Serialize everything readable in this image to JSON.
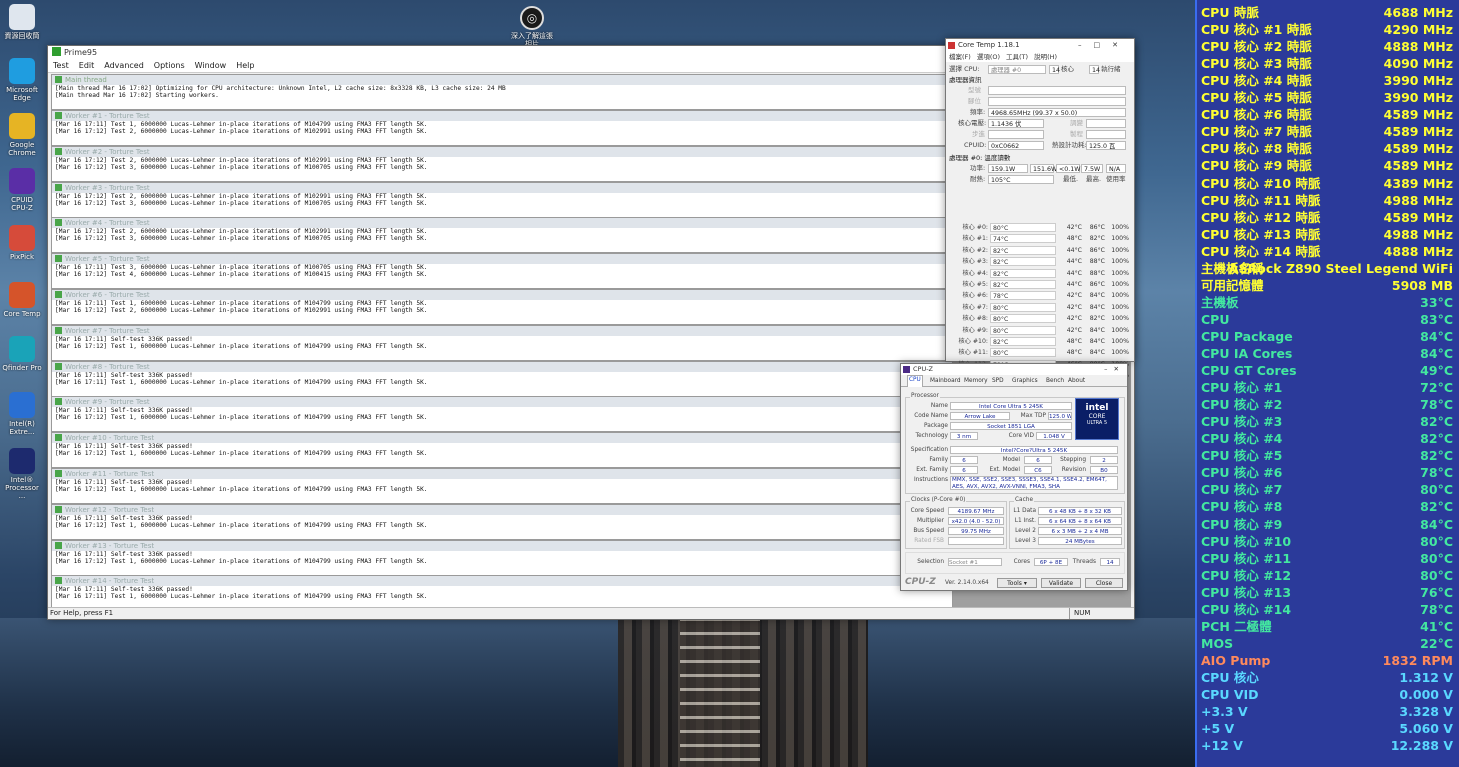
{
  "desktop": {
    "icons": [
      {
        "label": "資源回收筒",
        "icon": "recycle-bin-icon",
        "color": "#dfe6ee"
      },
      {
        "label": "Microsoft Edge",
        "icon": "edge-icon",
        "color": "#1f9de0"
      },
      {
        "label": "Google Chrome",
        "icon": "chrome-icon",
        "color": "#e6b424"
      },
      {
        "label": "CPUID CPU-Z",
        "icon": "cpuz-icon",
        "color": "#5a2ea6"
      },
      {
        "label": "PixPick",
        "icon": "pixpick-icon",
        "color": "#d64b3a"
      },
      {
        "label": "Core Temp",
        "icon": "coretemp-icon",
        "color": "#d5542a"
      },
      {
        "label": "Qfinder Pro",
        "icon": "qfinder-icon",
        "color": "#1aa3b8"
      },
      {
        "label": "Intel(R) Extre...",
        "icon": "intel-xtu-icon",
        "color": "#2a6fd2"
      },
      {
        "label": "Intel® Processor ...",
        "icon": "intel-pdt-icon",
        "color": "#1d2a6e"
      }
    ],
    "top_icon_label": "深入了解這張相片"
  },
  "prime95": {
    "title": "Prime95",
    "menu": [
      "Test",
      "Edit",
      "Advanced",
      "Options",
      "Window",
      "Help"
    ],
    "main_thread": {
      "title": "Main thread",
      "lines": [
        "[Main thread Mar 16 17:02] Optimizing for CPU architecture: Unknown Intel, L2 cache size: 8x3328 KB, L3 cache size: 24 MB",
        "[Main thread Mar 16 17:02] Starting workers."
      ]
    },
    "workers": [
      {
        "title": "Worker #1 - Torture Test",
        "lines": [
          "[Mar 16 17:11] Test 1, 6000000 Lucas-Lehmer in-place iterations of M104799 using FMA3 FFT length 5K.",
          "[Mar 16 17:12] Test 2, 6000000 Lucas-Lehmer in-place iterations of M102991 using FMA3 FFT length 5K."
        ]
      },
      {
        "title": "Worker #2 - Torture Test",
        "lines": [
          "[Mar 16 17:12] Test 2, 6000000 Lucas-Lehmer in-place iterations of M102991 using FMA3 FFT length 5K.",
          "[Mar 16 17:12] Test 3, 6000000 Lucas-Lehmer in-place iterations of M100705 using FMA3 FFT length 5K."
        ]
      },
      {
        "title": "Worker #3 - Torture Test",
        "lines": [
          "[Mar 16 17:12] Test 2, 6000000 Lucas-Lehmer in-place iterations of M102991 using FMA3 FFT length 5K.",
          "[Mar 16 17:12] Test 3, 6000000 Lucas-Lehmer in-place iterations of M100705 using FMA3 FFT length 5K."
        ]
      },
      {
        "title": "Worker #4 - Torture Test",
        "lines": [
          "[Mar 16 17:12] Test 2, 6000000 Lucas-Lehmer in-place iterations of M102991 using FMA3 FFT length 5K.",
          "[Mar 16 17:12] Test 3, 6000000 Lucas-Lehmer in-place iterations of M100705 using FMA3 FFT length 5K."
        ]
      },
      {
        "title": "Worker #5 - Torture Test",
        "lines": [
          "[Mar 16 17:11] Test 3, 6000000 Lucas-Lehmer in-place iterations of M100705 using FMA3 FFT length 5K.",
          "[Mar 16 17:12] Test 4, 6000000 Lucas-Lehmer in-place iterations of M100415 using FMA3 FFT length 5K."
        ]
      },
      {
        "title": "Worker #6 - Torture Test",
        "lines": [
          "[Mar 16 17:11] Test 1, 6000000 Lucas-Lehmer in-place iterations of M104799 using FMA3 FFT length 5K.",
          "[Mar 16 17:12] Test 2, 6000000 Lucas-Lehmer in-place iterations of M102991 using FMA3 FFT length 5K."
        ]
      },
      {
        "title": "Worker #7 - Torture Test",
        "lines": [
          "[Mar 16 17:11] Self-test 336K passed!",
          "[Mar 16 17:12] Test 1, 6000000 Lucas-Lehmer in-place iterations of M104799 using FMA3 FFT length 5K."
        ]
      },
      {
        "title": "Worker #8 - Torture Test",
        "lines": [
          "[Mar 16 17:11] Self-test 336K passed!",
          "[Mar 16 17:11] Test 1, 6000000 Lucas-Lehmer in-place iterations of M104799 using FMA3 FFT length 5K."
        ]
      },
      {
        "title": "Worker #9 - Torture Test",
        "lines": [
          "[Mar 16 17:11] Self-test 336K passed!",
          "[Mar 16 17:12] Test 1, 6000000 Lucas-Lehmer in-place iterations of M104799 using FMA3 FFT length 5K."
        ]
      },
      {
        "title": "Worker #10 - Torture Test",
        "lines": [
          "[Mar 16 17:11] Self-test 336K passed!",
          "[Mar 16 17:12] Test 1, 6000000 Lucas-Lehmer in-place iterations of M104799 using FMA3 FFT length 5K."
        ]
      },
      {
        "title": "Worker #11 - Torture Test",
        "lines": [
          "[Mar 16 17:11] Self-test 336K passed!",
          "[Mar 16 17:12] Test 1, 6000000 Lucas-Lehmer in-place iterations of M104799 using FMA3 FFT length 5K."
        ]
      },
      {
        "title": "Worker #12 - Torture Test",
        "lines": [
          "[Mar 16 17:11] Self-test 336K passed!",
          "[Mar 16 17:12] Test 1, 6000000 Lucas-Lehmer in-place iterations of M104799 using FMA3 FFT length 5K."
        ]
      },
      {
        "title": "Worker #13 - Torture Test",
        "lines": [
          "[Mar 16 17:11] Self-test 336K passed!",
          "[Mar 16 17:12] Test 1, 6000000 Lucas-Lehmer in-place iterations of M104799 using FMA3 FFT length 5K."
        ]
      },
      {
        "title": "Worker #14 - Torture Test",
        "lines": [
          "[Mar 16 17:11] Self-test 336K passed!",
          "[Mar 16 17:11] Test 1, 6000000 Lucas-Lehmer in-place iterations of M104799 using FMA3 FFT length 5K."
        ]
      }
    ],
    "status_left": "For Help, press F1",
    "status_num": "NUM"
  },
  "coretemp": {
    "title": "Core Temp 1.18.1",
    "menu": [
      "檔案(F)",
      "選項(O)",
      "工具(T)",
      "說明(H)"
    ],
    "select_cpu_label": "選擇 CPU:",
    "select_cpu_value": "處理器 #0",
    "cores_value": "14",
    "cores_label": "核心",
    "threads_value": "14",
    "threads_label": "執行緒",
    "proc_info_title": "處理器資訊",
    "model_label": "型號",
    "platform_label": "腳位",
    "freq_label": "頻率:",
    "freq_value": "4968.65MHz (99.37 x 50.0)",
    "vid_label": "核心電壓:",
    "vid_value": "1.1436 伏",
    "mod_label": "調變",
    "lith_label": "步進",
    "rev_label": "製程",
    "cpuid_label": "CPUID:",
    "cpuid_value": "0xC0662",
    "tdp_label": "熱設計功耗:",
    "tdp_value": "125.0 瓦",
    "reading_title": "處理器 #0: 溫度讀數",
    "power_label": "功率:",
    "power_values": [
      "159.1W",
      "151.6W",
      "<0.1W",
      "7.5W",
      "N/A"
    ],
    "tj_label": "耐熱:",
    "tj_value": "105°C",
    "col_min": "最低.",
    "col_max": "最高.",
    "col_load": "使用率",
    "cores": [
      {
        "label": "核心 #0:",
        "temp": "80°C",
        "min": "42°C",
        "max": "86°C",
        "load": "100%"
      },
      {
        "label": "核心 #1:",
        "temp": "74°C",
        "min": "48°C",
        "max": "82°C",
        "load": "100%"
      },
      {
        "label": "核心 #2:",
        "temp": "82°C",
        "min": "44°C",
        "max": "86°C",
        "load": "100%"
      },
      {
        "label": "核心 #3:",
        "temp": "82°C",
        "min": "44°C",
        "max": "88°C",
        "load": "100%"
      },
      {
        "label": "核心 #4:",
        "temp": "82°C",
        "min": "44°C",
        "max": "88°C",
        "load": "100%"
      },
      {
        "label": "核心 #5:",
        "temp": "82°C",
        "min": "44°C",
        "max": "86°C",
        "load": "100%"
      },
      {
        "label": "核心 #6:",
        "temp": "78°C",
        "min": "42°C",
        "max": "84°C",
        "load": "100%"
      },
      {
        "label": "核心 #7:",
        "temp": "80°C",
        "min": "42°C",
        "max": "84°C",
        "load": "100%"
      },
      {
        "label": "核心 #8:",
        "temp": "80°C",
        "min": "42°C",
        "max": "82°C",
        "load": "100%"
      },
      {
        "label": "核心 #9:",
        "temp": "80°C",
        "min": "42°C",
        "max": "84°C",
        "load": "100%"
      },
      {
        "label": "核心 #10:",
        "temp": "82°C",
        "min": "48°C",
        "max": "84°C",
        "load": "100%"
      },
      {
        "label": "核心 #11:",
        "temp": "80°C",
        "min": "48°C",
        "max": "84°C",
        "load": "100%"
      },
      {
        "label": "核心 #12:",
        "temp": "78°C",
        "min": "46°C",
        "max": "80°C",
        "load": "100%"
      },
      {
        "label": "核心 #13:",
        "temp": "76°C",
        "min": "44°C",
        "max": "78°C",
        "load": "100%"
      }
    ]
  },
  "cpuz": {
    "title": "CPU-Z",
    "tabs": [
      "CPU",
      "Mainboard",
      "Memory",
      "SPD",
      "Graphics",
      "Bench",
      "About"
    ],
    "processor_group": "Processor",
    "name_label": "Name",
    "name_value": "Intel Core Ultra 5 245K",
    "codename_label": "Code Name",
    "codename_value": "Arrow Lake",
    "maxtdp_label": "Max TDP",
    "maxtdp_value": "125.0 W",
    "package_label": "Package",
    "package_value": "Socket 1851 LGA",
    "tech_label": "Technology",
    "tech_value": "3 nm",
    "corevid_label": "Core VID",
    "corevid_value": "1.048 V",
    "spec_label": "Specification",
    "spec_value": "Intel?Core?Ultra 5 245K",
    "family_label": "Family",
    "family_value": "6",
    "model_label": "Model",
    "model_value": "6",
    "stepping_label": "Stepping",
    "stepping_value": "2",
    "extfamily_label": "Ext. Family",
    "extfamily_value": "6",
    "extmodel_label": "Ext. Model",
    "extmodel_value": "C6",
    "revision_label": "Revision",
    "revision_value": "B0",
    "instr_label": "Instructions",
    "instr_value": "MMX, SSE, SSE2, SSE3, SSSE3, SSE4.1, SSE4.2, EM64T, AES, AVX, AVX2, AVX-VNNI, FMA3, SHA",
    "logo_brand": "intel",
    "logo_line": "CORE",
    "logo_sub": "ULTRA",
    "logo_num": "5",
    "clocks_group": "Clocks (P-Core #0)",
    "corespeed_label": "Core Speed",
    "corespeed_value": "4189.67 MHz",
    "mult_label": "Multiplier",
    "mult_value": "x42.0 (4.0 - 52.0)",
    "bus_label": "Bus Speed",
    "bus_value": "99.75 MHz",
    "fsb_label": "Rated FSB",
    "fsb_value": "",
    "cache_group": "Cache",
    "l1d_label": "L1 Data",
    "l1d_value": "6 x 48 KB + 8 x 32 KB",
    "l1i_label": "L1 Inst.",
    "l1i_value": "6 x 64 KB + 8 x 64 KB",
    "l2_label": "Level 2",
    "l2_value": "6 x 3 MB + 2 x 4 MB",
    "l3_label": "Level 3",
    "l3_value": "24 MBytes",
    "selection_label": "Selection",
    "selection_value": "Socket #1",
    "cores_label": "Cores",
    "cores_value": "6P + 8E",
    "threads_label": "Threads",
    "threads_value": "14",
    "brand": "CPU-Z",
    "version": "Ver. 2.14.0.x64",
    "tools_btn": "Tools",
    "validate_btn": "Validate",
    "close_btn": "Close"
  },
  "sensors": [
    {
      "label": "CPU 時脈",
      "value": "4688 MHz",
      "color": "#ffff33"
    },
    {
      "label": "CPU 核心 #1 時脈",
      "value": "4290 MHz",
      "color": "#ffff33"
    },
    {
      "label": "CPU 核心 #2 時脈",
      "value": "4888 MHz",
      "color": "#ffff33"
    },
    {
      "label": "CPU 核心 #3 時脈",
      "value": "4090 MHz",
      "color": "#ffff33"
    },
    {
      "label": "CPU 核心 #4 時脈",
      "value": "3990 MHz",
      "color": "#ffff33"
    },
    {
      "label": "CPU 核心 #5 時脈",
      "value": "3990 MHz",
      "color": "#ffff33"
    },
    {
      "label": "CPU 核心 #6 時脈",
      "value": "4589 MHz",
      "color": "#ffff33"
    },
    {
      "label": "CPU 核心 #7 時脈",
      "value": "4589 MHz",
      "color": "#ffff33"
    },
    {
      "label": "CPU 核心 #8 時脈",
      "value": "4589 MHz",
      "color": "#ffff33"
    },
    {
      "label": "CPU 核心 #9 時脈",
      "value": "4589 MHz",
      "color": "#ffff33"
    },
    {
      "label": "CPU 核心 #10 時脈",
      "value": "4389 MHz",
      "color": "#ffff33"
    },
    {
      "label": "CPU 核心 #11 時脈",
      "value": "4988 MHz",
      "color": "#ffff33"
    },
    {
      "label": "CPU 核心 #12 時脈",
      "value": "4589 MHz",
      "color": "#ffff33"
    },
    {
      "label": "CPU 核心 #13 時脈",
      "value": "4988 MHz",
      "color": "#ffff33"
    },
    {
      "label": "CPU 核心 #14 時脈",
      "value": "4888 MHz",
      "color": "#ffff33"
    },
    {
      "label": "主機板名稱",
      "value": "ASRock Z890 Steel Legend WiFi",
      "color": "#ffff33"
    },
    {
      "label": "可用記憶體",
      "value": "5908 MB",
      "color": "#ffff33"
    },
    {
      "label": "主機板",
      "value": "33°C",
      "color": "#43e8a0"
    },
    {
      "label": "CPU",
      "value": "83°C",
      "color": "#43e8a0"
    },
    {
      "label": "CPU Package",
      "value": "84°C",
      "color": "#43e8a0"
    },
    {
      "label": "CPU IA Cores",
      "value": "84°C",
      "color": "#43e8a0"
    },
    {
      "label": "CPU GT Cores",
      "value": "49°C",
      "color": "#43e8a0"
    },
    {
      "label": "CPU 核心 #1",
      "value": "72°C",
      "color": "#43e8a0"
    },
    {
      "label": "CPU 核心 #2",
      "value": "78°C",
      "color": "#43e8a0"
    },
    {
      "label": "CPU 核心 #3",
      "value": "82°C",
      "color": "#43e8a0"
    },
    {
      "label": "CPU 核心 #4",
      "value": "82°C",
      "color": "#43e8a0"
    },
    {
      "label": "CPU 核心 #5",
      "value": "82°C",
      "color": "#43e8a0"
    },
    {
      "label": "CPU 核心 #6",
      "value": "78°C",
      "color": "#43e8a0"
    },
    {
      "label": "CPU 核心 #7",
      "value": "80°C",
      "color": "#43e8a0"
    },
    {
      "label": "CPU 核心 #8",
      "value": "82°C",
      "color": "#43e8a0"
    },
    {
      "label": "CPU 核心 #9",
      "value": "84°C",
      "color": "#43e8a0"
    },
    {
      "label": "CPU 核心 #10",
      "value": "80°C",
      "color": "#43e8a0"
    },
    {
      "label": "CPU 核心 #11",
      "value": "80°C",
      "color": "#43e8a0"
    },
    {
      "label": "CPU 核心 #12",
      "value": "80°C",
      "color": "#43e8a0"
    },
    {
      "label": "CPU 核心 #13",
      "value": "76°C",
      "color": "#43e8a0"
    },
    {
      "label": "CPU 核心 #14",
      "value": "78°C",
      "color": "#43e8a0"
    },
    {
      "label": "PCH 二極體",
      "value": "41°C",
      "color": "#43e8a0"
    },
    {
      "label": "MOS",
      "value": "22°C",
      "color": "#43e8a0"
    },
    {
      "label": "AIO Pump",
      "value": "1832 RPM",
      "color": "#ff8a5c"
    },
    {
      "label": "CPU 核心",
      "value": "1.312 V",
      "color": "#5ad8ff"
    },
    {
      "label": "CPU VID",
      "value": "0.000 V",
      "color": "#5ad8ff"
    },
    {
      "label": "+3.3 V",
      "value": "3.328 V",
      "color": "#5ad8ff"
    },
    {
      "label": "+5 V",
      "value": "5.060 V",
      "color": "#5ad8ff"
    },
    {
      "label": "+12 V",
      "value": "12.288 V",
      "color": "#5ad8ff"
    }
  ]
}
